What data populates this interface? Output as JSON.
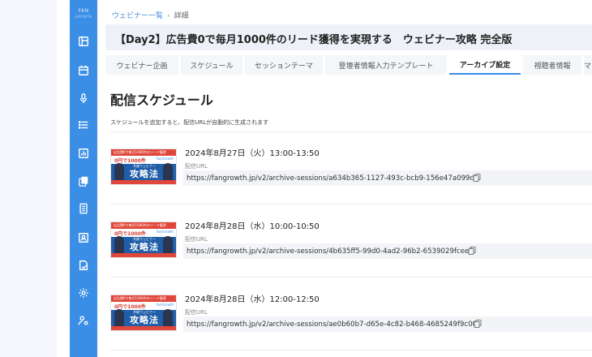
{
  "sidebar": {
    "logo_text": "FAN",
    "logo_sub": "GROWTH",
    "items": [
      {
        "name": "dashboard-icon"
      },
      {
        "name": "calendar-icon"
      },
      {
        "name": "microphone-icon"
      },
      {
        "name": "list-icon"
      },
      {
        "name": "chart-icon"
      },
      {
        "name": "copy-icon"
      },
      {
        "name": "building-icon"
      },
      {
        "name": "contact-card-icon"
      },
      {
        "name": "document-check-icon"
      },
      {
        "name": "settings-icon"
      },
      {
        "name": "users-settings-icon"
      }
    ],
    "color": "#3a8ee6"
  },
  "breadcrumb": {
    "parent": "ウェビナー一覧",
    "separator": "›",
    "current": "詳細"
  },
  "page": {
    "title": "【Day2】広告費0で毎月1000件のリード獲得を実現する　ウェビナー攻略 完全版"
  },
  "tabs": [
    {
      "label": "ウェビナー企画",
      "active": false
    },
    {
      "label": "スケジュール",
      "active": false
    },
    {
      "label": "セッションテーマ",
      "active": false
    },
    {
      "label": "登壇者情報入力テンプレート",
      "active": false
    },
    {
      "label": "アーカイブ設定",
      "active": true
    },
    {
      "label": "視聴者情報",
      "active": false
    },
    {
      "label": "マ",
      "active": false
    }
  ],
  "section": {
    "title": "配信スケジュール",
    "note": "スケジュールを追加すると、配信URLが自動的に生成されます"
  },
  "schedules": [
    {
      "datetime": "2024年8月27日（火）13:00-13:50",
      "url_label": "配信URL",
      "url": "https://fangrowth.jp/v2/archive-sessions/a634b365-1127-493c-bcb9-156e47a099da"
    },
    {
      "datetime": "2024年8月28日（水）10:00-10:50",
      "url_label": "配信URL",
      "url": "https://fangrowth.jp/v2/archive-sessions/4b635ff5-99d0-4ad2-96b2-6539029fceef"
    },
    {
      "datetime": "2024年8月28日（水）12:00-12:50",
      "url_label": "配信URL",
      "url": "https://fangrowth.jp/v2/archive-sessions/ae0b60b7-d65e-4c82-b468-4685249f9c00"
    }
  ],
  "thumbnail": {
    "top_text": "広告費0で毎月1000件のリード獲得",
    "count_text": "0円で1000件",
    "brand": "FanGrowth",
    "sub_text": "共催ウェビナー",
    "main_text": "攻略法"
  },
  "colors": {
    "accent": "#3a8ee6",
    "active_tab_border": "#3a8ee6",
    "link": "#4a8fd9"
  }
}
